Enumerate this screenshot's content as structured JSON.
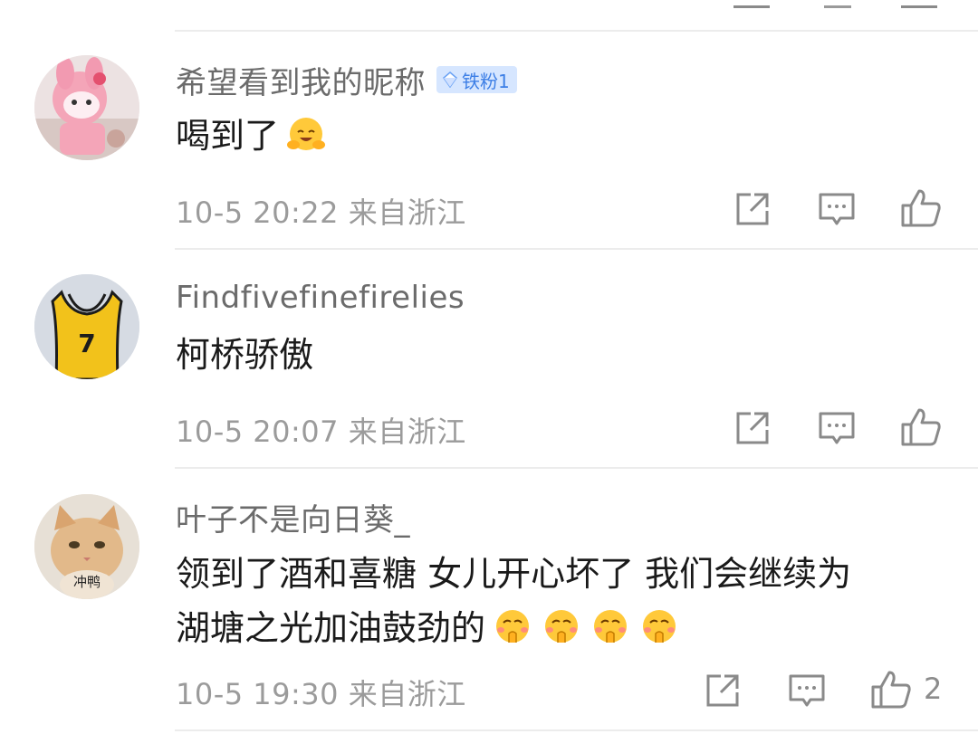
{
  "comments": [
    {
      "username": "希望看到我的昵称",
      "badge": "铁粉1",
      "content": [
        "喝到了"
      ],
      "emoji_count": 1,
      "timestamp": "10-5 20:22",
      "location": "来自浙江",
      "like_count": ""
    },
    {
      "username": "Findfivefinefirelies",
      "badge": "",
      "content": [
        "柯桥骄傲"
      ],
      "emoji_count": 0,
      "timestamp": "10-5 20:07",
      "location": "来自浙江",
      "like_count": ""
    },
    {
      "username": "叶子不是向日葵_",
      "badge": "",
      "content": [
        "领到了酒和喜糖 女儿开心坏了 我们会继续为",
        "湖塘之光加油鼓劲的"
      ],
      "emoji_count": 4,
      "avatar_label": "冲鸭",
      "timestamp": "10-5 19:30",
      "location": "来自浙江",
      "like_count": "2"
    }
  ],
  "avatar2_text": "7",
  "icons": {
    "share": "share-icon",
    "reply": "comment-icon",
    "like": "thumbs-up-icon",
    "badge": "diamond-icon"
  },
  "colors": {
    "badge_bg": "#d6e6ff",
    "badge_text": "#3d7fe6",
    "meta_text": "#9b9b9b",
    "username_text": "#6b6b6b"
  }
}
